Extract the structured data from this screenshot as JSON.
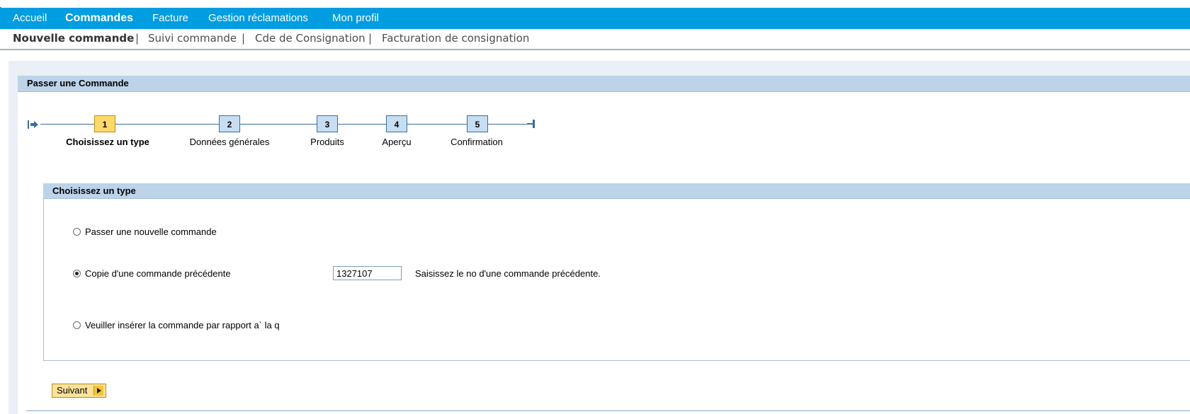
{
  "topnav": {
    "items": [
      "Accueil",
      "Commandes",
      "Facture",
      "Gestion réclamations",
      "Mon profil"
    ],
    "active": "Commandes"
  },
  "subnav": {
    "items": [
      "Nouvelle commande",
      "Suivi commande",
      "Cde de Consignation",
      "Facturation de consignation"
    ],
    "separator": "|",
    "active": "Nouvelle commande"
  },
  "panel": {
    "title": "Passer une Commande"
  },
  "roadmap": {
    "steps": [
      {
        "number": "1",
        "label": "Choisissez un type"
      },
      {
        "number": "2",
        "label": "Données générales"
      },
      {
        "number": "3",
        "label": "Produits"
      },
      {
        "number": "4",
        "label": "Aperçu"
      },
      {
        "number": "5",
        "label": "Confirmation"
      }
    ],
    "current_step": "1"
  },
  "group": {
    "title": "Choisissez un type",
    "options": [
      {
        "label": "Passer une nouvelle commande",
        "selected": false
      },
      {
        "label": "Copie d'une commande précédente",
        "selected": true
      },
      {
        "label": "Veuiller insérer la commande par rapport a` la q",
        "selected": false
      }
    ],
    "order_number_value": "1327107",
    "order_number_hint": "Saisissez le no d'une commande précédente."
  },
  "actions": {
    "next_label": "Suivant"
  },
  "colors": {
    "topnav_bg": "#009de0",
    "title_bar_bg": "#bcd3e9",
    "current_step_bg": "#ffd96a",
    "step_bg": "#c6ddf2",
    "button_bg": "#fde39a"
  }
}
